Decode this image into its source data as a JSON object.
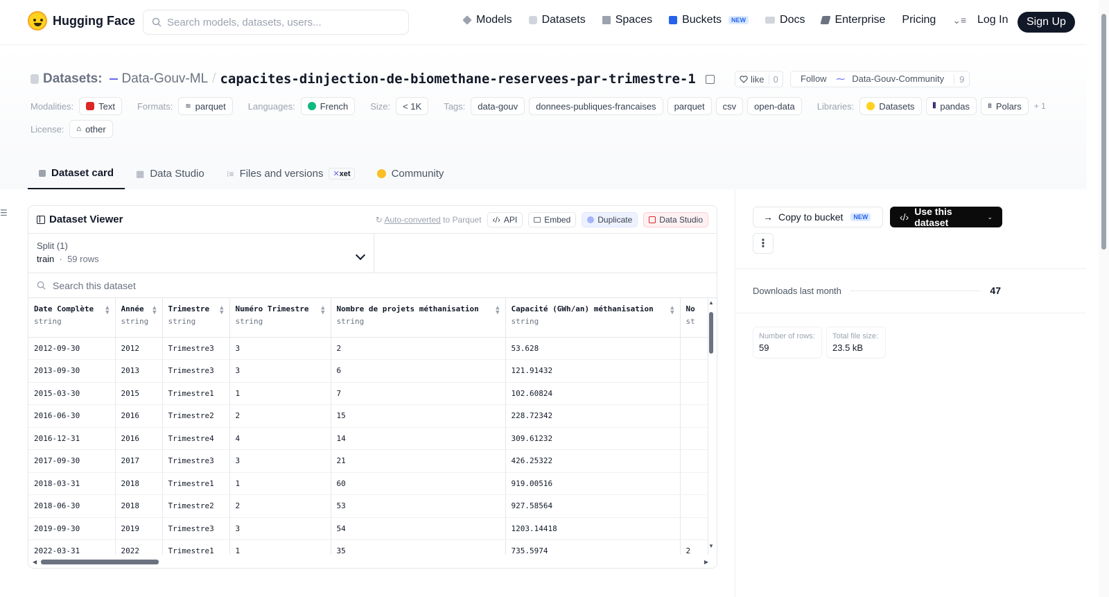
{
  "nav": {
    "brand": "Hugging Face",
    "search_placeholder": "Search models, datasets, users...",
    "items": [
      {
        "label": "Models",
        "icon": "cube-icon",
        "color": "#6b7280"
      },
      {
        "label": "Datasets",
        "icon": "database-icon",
        "color": "#9ca3af"
      },
      {
        "label": "Spaces",
        "icon": "grid-icon",
        "color": "#6b7280"
      },
      {
        "label": "Buckets",
        "icon": "bucket-icon",
        "color": "#2563eb",
        "badge": "NEW"
      },
      {
        "label": "Docs",
        "icon": "book-icon",
        "color": "#6b7280"
      },
      {
        "label": "Enterprise",
        "icon": "enterprise-icon",
        "color": "#6b7280"
      },
      {
        "label": "Pricing"
      }
    ],
    "login": "Log In",
    "signup": "Sign Up"
  },
  "repo": {
    "category": "Datasets:",
    "org": "Data-Gouv-ML",
    "separator": "/",
    "name": "capacites-dinjection-de-biomethane-reservees-par-trimestre-1",
    "like_label": "like",
    "like_count": "0",
    "follow_label": "Follow",
    "follow_org": "Data-Gouv-Community",
    "follow_count": "9"
  },
  "meta": {
    "modalities_label": "Modalities:",
    "modality": "Text",
    "formats_label": "Formats:",
    "format": "parquet",
    "languages_label": "Languages:",
    "language": "French",
    "size_label": "Size:",
    "size": "< 1K",
    "tags_label": "Tags:",
    "tags": [
      "data-gouv",
      "donnees-publiques-francaises",
      "parquet",
      "csv",
      "open-data"
    ],
    "libraries_label": "Libraries:",
    "libraries": [
      "Datasets",
      "pandas",
      "Polars"
    ],
    "libraries_more": "+ 1",
    "license_label": "License:",
    "license": "other"
  },
  "tabs": [
    {
      "label": "Dataset card",
      "active": true
    },
    {
      "label": "Data Studio"
    },
    {
      "label": "Files and versions",
      "badge": "xet"
    },
    {
      "label": "Community"
    }
  ],
  "viewer": {
    "title": "Dataset Viewer",
    "auto_converted_link": "Auto-converted",
    "auto_converted_rest": " to Parquet",
    "buttons": [
      "API",
      "Embed",
      "Duplicate",
      "Data Studio"
    ],
    "split_label": "Split (1)",
    "split_value": "train",
    "split_rows": "59 rows",
    "search_placeholder": "Search this dataset",
    "columns": [
      {
        "name": "Date Complète",
        "type": "string"
      },
      {
        "name": "Année",
        "type": "string"
      },
      {
        "name": "Trimestre",
        "type": "string"
      },
      {
        "name": "Numéro Trimestre",
        "type": "string"
      },
      {
        "name": "Nombre de projets méthanisation",
        "type": "string"
      },
      {
        "name": "Capacité (GWh/an) méthanisation",
        "type": "string"
      },
      {
        "name": "No",
        "type": "st"
      }
    ],
    "rows": [
      [
        "2012-09-30",
        "2012",
        "Trimestre3",
        "3",
        "2",
        "53.628",
        ""
      ],
      [
        "2013-09-30",
        "2013",
        "Trimestre3",
        "3",
        "6",
        "121.91432",
        ""
      ],
      [
        "2015-03-30",
        "2015",
        "Trimestre1",
        "1",
        "7",
        "102.60824",
        ""
      ],
      [
        "2016-06-30",
        "2016",
        "Trimestre2",
        "2",
        "15",
        "228.72342",
        ""
      ],
      [
        "2016-12-31",
        "2016",
        "Trimestre4",
        "4",
        "14",
        "309.61232",
        ""
      ],
      [
        "2017-09-30",
        "2017",
        "Trimestre3",
        "3",
        "21",
        "426.25322",
        ""
      ],
      [
        "2018-03-31",
        "2018",
        "Trimestre1",
        "1",
        "60",
        "919.00516",
        ""
      ],
      [
        "2018-06-30",
        "2018",
        "Trimestre2",
        "2",
        "53",
        "927.58564",
        ""
      ],
      [
        "2019-09-30",
        "2019",
        "Trimestre3",
        "3",
        "54",
        "1203.14418",
        ""
      ],
      [
        "2022-03-31",
        "2022",
        "Trimestre1",
        "1",
        "35",
        "735.5974",
        "2"
      ]
    ]
  },
  "sidebar": {
    "copy_bucket": "Copy to bucket",
    "copy_bucket_badge": "NEW",
    "use_dataset": "Use this dataset",
    "downloads_label": "Downloads last month",
    "downloads_value": "47",
    "rows_label": "Number of rows:",
    "rows_value": "59",
    "size_label": "Total file size:",
    "size_value": "23.5 kB"
  }
}
